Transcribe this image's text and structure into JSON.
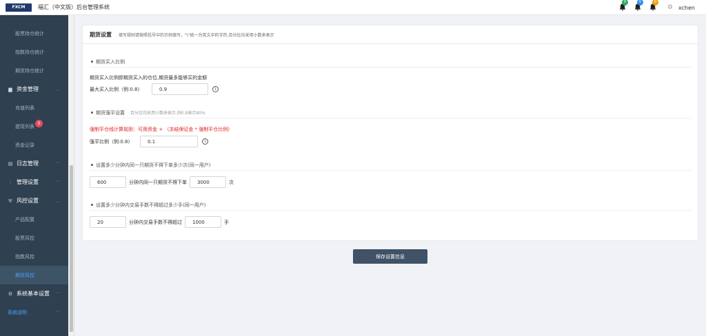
{
  "header": {
    "logo_text": "FXCM",
    "app_title": "福汇（中文版）后台管理系统",
    "notifications": [
      {
        "icon": "bell-icon",
        "count": "0",
        "color": "#27ae60"
      },
      {
        "icon": "bell-icon",
        "count": "0",
        "color": "#2d8cf0"
      },
      {
        "icon": "bell-icon",
        "count": "0",
        "color": "#f39c12"
      }
    ],
    "settings_icon": "gear-icon",
    "username": "xchen"
  },
  "sidebar": {
    "items_top": [
      {
        "label": "股票持仓统计"
      },
      {
        "label": "指数持仓统计"
      },
      {
        "label": "期货持仓统计"
      }
    ],
    "fund_group": {
      "label": "资金管理",
      "icon": "folder-icon"
    },
    "fund_items": [
      {
        "label": "充值列表"
      },
      {
        "label": "提现列表",
        "badge": "0"
      },
      {
        "label": "资金记录"
      }
    ],
    "log_group": {
      "label": "日志管理",
      "icon": "list-icon"
    },
    "admin_group": {
      "label": "管理设置",
      "icon": "sliders-icon"
    },
    "risk_group": {
      "label": "风控设置",
      "icon": "shield-icon"
    },
    "risk_items": [
      {
        "label": "产品配置"
      },
      {
        "label": "股票风控"
      },
      {
        "label": "指数风控"
      },
      {
        "label": "期货风控"
      }
    ],
    "system_group": {
      "label": "系统基本设置",
      "icon": "gear-icon"
    },
    "footer": {
      "label": "系统说明"
    }
  },
  "panel": {
    "title": "期货设置",
    "hint": "填写规则请按照括号中的示例填写，\"\\\"统一为英文中的字符,百分比均采用小数来表示",
    "buy_section": {
      "title": "期货买入比例",
      "desc": "期货买入比例即期货买入的仓位,期货最多能够买的金额",
      "label": "最大买入比例（例:0.8)",
      "value": "0.9"
    },
    "force_section": {
      "title": "期货强平设置",
      "subtitle": "百分比均采用小数来表示,例0.8表示80%",
      "rule": "强制平仓线计算规则：可用资金 + （冻结保证金 * 强制平仓比例)",
      "label": "强平比例（例:0.8)",
      "value": "0.1"
    },
    "order_section": {
      "title": "设置多少分钟内同一只期货不得下单多少次(同一用户)",
      "minutes": "600",
      "middle_text": "分钟内同一只期货不得下单",
      "count": "3000",
      "unit": "次"
    },
    "lots_section": {
      "title": "设置多少分钟内交易手数不得超过多少手(同一用户)",
      "minutes": "20",
      "middle_text": "分钟内交易手数不得超过",
      "count": "1000",
      "unit": "手"
    }
  },
  "save_button": "保存设置信息"
}
